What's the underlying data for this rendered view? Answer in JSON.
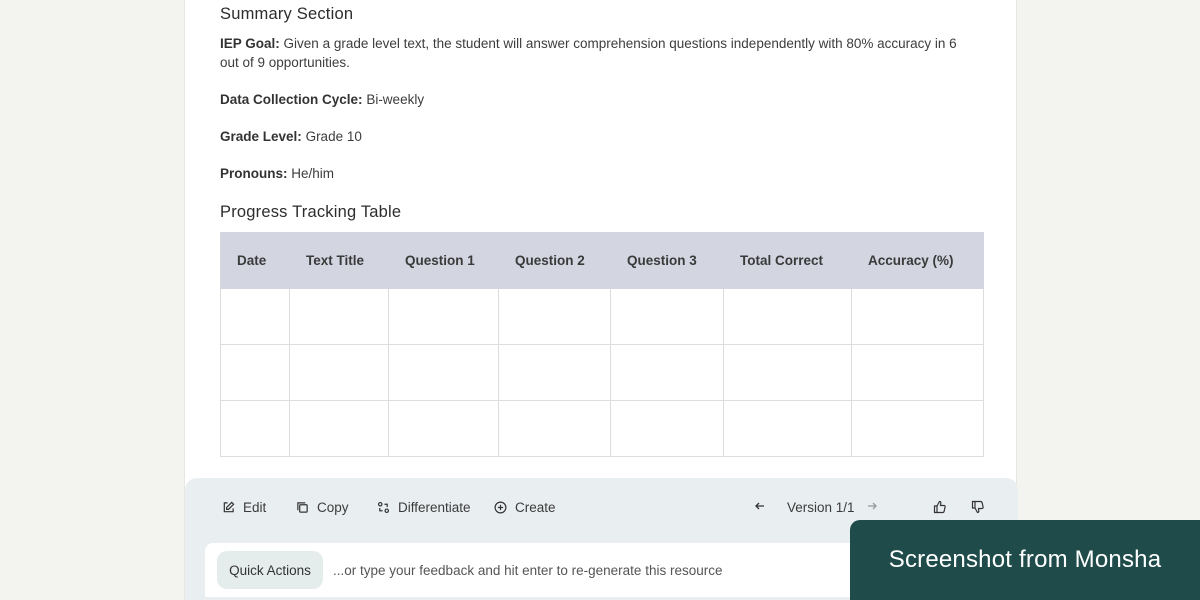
{
  "summary": {
    "title": "Summary Section",
    "iep_goal_label": "IEP Goal:",
    "iep_goal_text": "Given a grade level text, the student will answer comprehension questions independently with 80% accuracy in 6 out of 9 opportunities.",
    "cycle_label": "Data Collection Cycle:",
    "cycle_value": "Bi-weekly",
    "grade_label": "Grade Level:",
    "grade_value": "Grade 10",
    "pronouns_label": "Pronouns:",
    "pronouns_value": "He/him"
  },
  "progress": {
    "title": "Progress Tracking Table",
    "columns": [
      "Date",
      "Text Title",
      "Question 1",
      "Question 2",
      "Question 3",
      "Total Correct",
      "Accuracy (%)"
    ]
  },
  "toolbar": {
    "edit": "Edit",
    "copy": "Copy",
    "differentiate": "Differentiate",
    "create": "Create",
    "version": "Version 1/1"
  },
  "feedback": {
    "quick_actions": "Quick Actions",
    "placeholder": "...or type your feedback and hit enter to re-generate this resource"
  },
  "badge": {
    "text": "Screenshot from Monsha"
  },
  "colors": {
    "table_header": "#d3d6e1",
    "toolbar_bg": "#e9eef0",
    "badge_bg": "#1f4c4b"
  }
}
